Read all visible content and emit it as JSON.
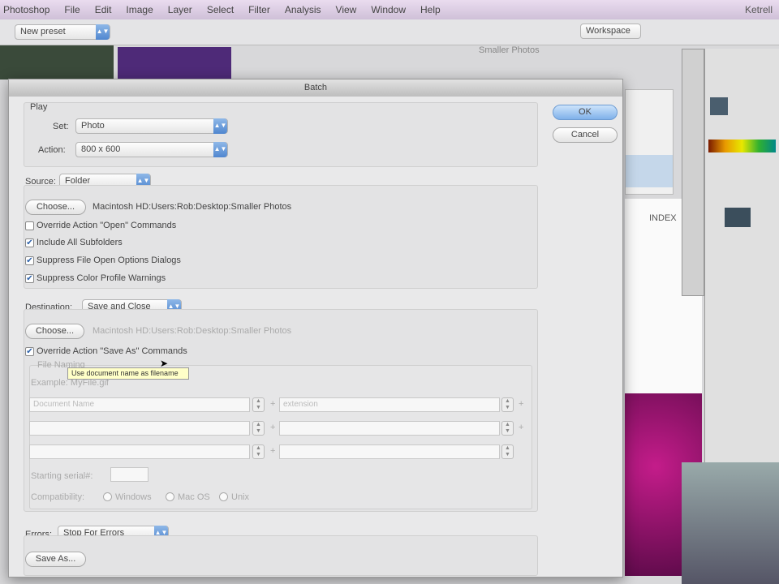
{
  "menubar": {
    "items": [
      "Photoshop",
      "File",
      "Edit",
      "Image",
      "Layer",
      "Select",
      "Filter",
      "Analysis",
      "View",
      "Window",
      "Help"
    ],
    "user": "Ketrell"
  },
  "optbar": {
    "preset": "New preset",
    "workspace": "Workspace"
  },
  "background": {
    "folder_label": "Smaller Photos",
    "doc_label": "INDEX"
  },
  "dialog": {
    "title": "Batch",
    "ok": "OK",
    "cancel": "Cancel",
    "play": {
      "label": "Play",
      "set_label": "Set:",
      "set_value": "Photo",
      "action_label": "Action:",
      "action_value": "800 x 600"
    },
    "source": {
      "label": "Source:",
      "value": "Folder",
      "choose": "Choose...",
      "path": "Macintosh HD:Users:Rob:Desktop:Smaller Photos",
      "options": [
        {
          "label": "Override Action \"Open\" Commands",
          "checked": false
        },
        {
          "label": "Include All Subfolders",
          "checked": true
        },
        {
          "label": "Suppress File Open Options Dialogs",
          "checked": true
        },
        {
          "label": "Suppress Color Profile Warnings",
          "checked": true
        }
      ]
    },
    "destination": {
      "label": "Destination:",
      "value": "Save and Close",
      "choose": "Choose...",
      "path": "Macintosh HD:Users:Rob:Desktop:Smaller Photos",
      "override": "Override Action \"Save As\" Commands",
      "tooltip": "Use document name as filename",
      "file_naming": "File Naming",
      "example": "Example: MyFile.gif",
      "row1_left": "Document Name",
      "row1_right": "extension",
      "plus": "+",
      "serial_label": "Starting serial#:",
      "compat_label": "Compatibility:",
      "compat": [
        "Windows",
        "Mac OS",
        "Unix"
      ]
    },
    "errors": {
      "label": "Errors:",
      "value": "Stop For Errors",
      "save_as": "Save As..."
    }
  }
}
